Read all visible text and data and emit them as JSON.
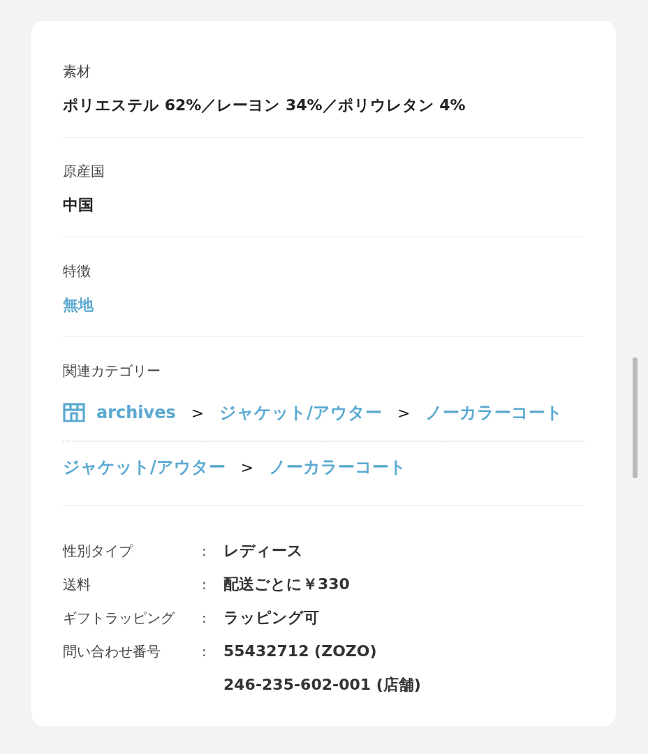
{
  "sections": [
    {
      "kind": "text",
      "label": "素材",
      "value": "ポリエステル 62%／レーヨン 34%／ポリウレタン 4%"
    },
    {
      "kind": "text",
      "label": "原産国",
      "value": "中国"
    },
    {
      "kind": "link",
      "label": "特徴",
      "value": "無地"
    }
  ],
  "categories": {
    "label": "関連カテゴリー",
    "paths": [
      {
        "crumbs": [
          {
            "kind": "shop",
            "text": "archives"
          },
          {
            "kind": "separator",
            "text": ">"
          },
          {
            "kind": "link",
            "text": "ジャケット/アウター"
          },
          {
            "kind": "separator",
            "text": ">"
          },
          {
            "kind": "link",
            "text": "ノーカラーコート"
          }
        ]
      },
      {
        "crumbs": [
          {
            "kind": "link",
            "text": "ジャケット/アウター"
          },
          {
            "kind": "separator",
            "text": ">"
          },
          {
            "kind": "link",
            "text": "ノーカラーコート"
          }
        ]
      }
    ]
  },
  "details": [
    {
      "label": "性別タイプ",
      "colon": ":",
      "values": [
        "レディース"
      ]
    },
    {
      "label": "送料",
      "colon": ":",
      "values": [
        "配送ごとに￥330"
      ]
    },
    {
      "label": "ギフトラッピング",
      "colon": ":",
      "values": [
        "ラッピング可"
      ]
    },
    {
      "label": "問い合わせ番号",
      "colon": ":",
      "values": [
        "55432712 (ZOZO)",
        "246-235-602-001 (店舗)"
      ]
    }
  ]
}
